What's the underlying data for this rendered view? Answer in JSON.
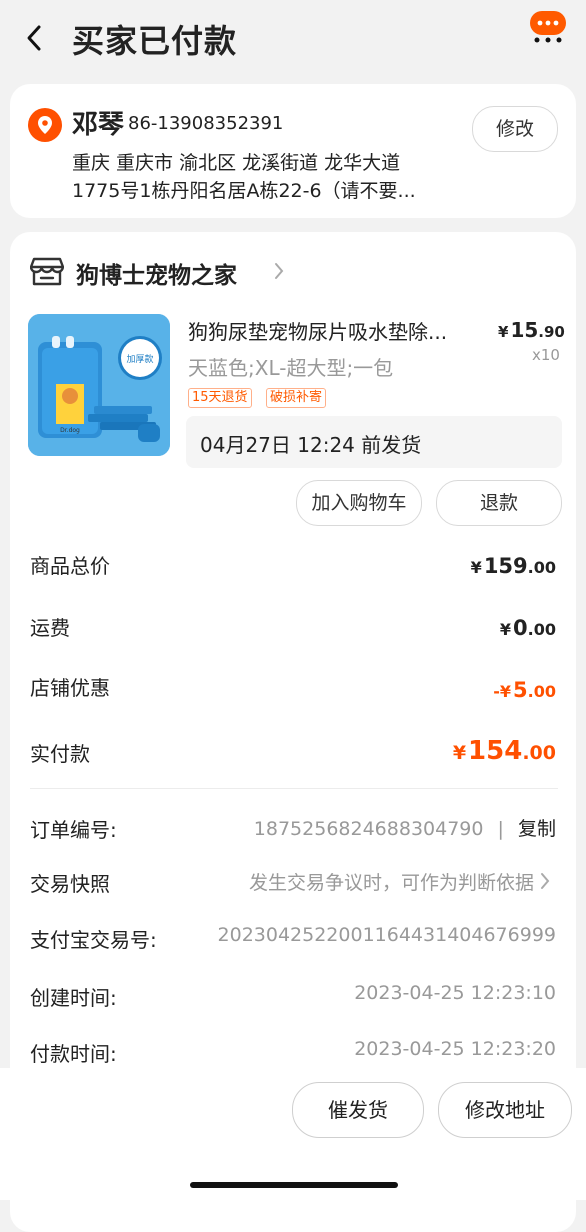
{
  "header": {
    "title": "买家已付款"
  },
  "address": {
    "name": "邓琴",
    "phone": "86-13908352391",
    "line1": "重庆 重庆市 渝北区 龙溪街道 龙华大道",
    "line2": "1775号1栋丹阳名居A栋22-6（请不要...",
    "edit_label": "修改"
  },
  "shop": {
    "name": "狗博士宠物之家"
  },
  "product": {
    "title": "狗狗尿垫宠物尿片吸水垫除...",
    "price_symbol": "¥",
    "price_int": "15",
    "price_dec": ".90",
    "spec": "天蓝色;XL-超大型;一包",
    "qty": "x10",
    "tags": [
      "15天退货",
      "破损补寄"
    ],
    "badge": "加厚款",
    "brand": "Dr.dog",
    "ship_text": "04月27日 12:24 前发货",
    "add_cart_label": "加入购物车",
    "refund_label": "退款"
  },
  "summary": {
    "goods_total_label": "商品总价",
    "goods_total_sym": "¥",
    "goods_total_int": "159",
    "goods_total_dec": ".00",
    "shipping_label": "运费",
    "shipping_sym": "¥",
    "shipping_int": "0",
    "shipping_dec": ".00",
    "discount_label": "店铺优惠",
    "discount_sym": "-¥",
    "discount_int": "5",
    "discount_dec": ".00",
    "paid_label": "实付款",
    "paid_sym": "¥",
    "paid_int": "154",
    "paid_dec": ".00"
  },
  "meta": {
    "order_no_label": "订单编号:",
    "order_no": "1875256824688304790",
    "order_sep": "|",
    "copy_label": "复制",
    "snapshot_label": "交易快照",
    "snapshot_value": "发生交易争议时，可作为判断依据",
    "alipay_label": "支付宝交易号:",
    "alipay_value": "2023042522001164431404676999",
    "created_label": "创建时间:",
    "created_value": "2023-04-25 12:23:10",
    "paid_time_label": "付款时间:",
    "paid_time_value": "2023-04-25 12:23:20"
  },
  "bottom": {
    "urge_label": "催发货",
    "modify_addr_label": "修改地址"
  },
  "colors": {
    "accent": "#ff5000",
    "more_btn": "#ff5a00"
  },
  "icons": [
    "back-icon",
    "more-icon",
    "location-icon",
    "shop-icon",
    "chevron-right-icon"
  ]
}
